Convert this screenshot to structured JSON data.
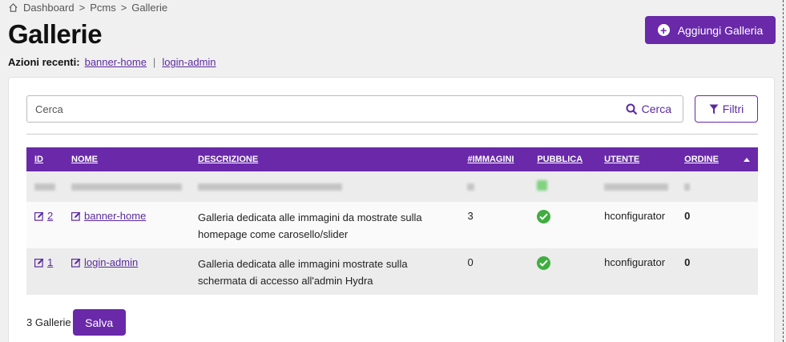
{
  "breadcrumb": {
    "items": [
      "Dashboard",
      "Pcms",
      "Gallerie"
    ],
    "separator": ">"
  },
  "page": {
    "title": "Gallerie"
  },
  "recent": {
    "label": "Azioni recenti",
    "colon": ":",
    "links": [
      "banner-home",
      "login-admin"
    ],
    "separator": "|"
  },
  "actions": {
    "add_label": "Aggiungi Galleria",
    "filter_label": "Filtri",
    "search_label": "Cerca"
  },
  "search": {
    "placeholder": "Cerca",
    "value": ""
  },
  "table": {
    "headers": {
      "id": "ID",
      "nome": "NOME",
      "descrizione": "DESCRIZIONE",
      "immagini": "#IMMAGINI",
      "pubblica": "PUBBLICA",
      "utente": "UTENTE",
      "ordine": "ORDINE"
    },
    "rows": [
      {
        "id": "2",
        "nome": "banner-home",
        "descrizione": "Galleria dedicata alle immagini da mostrate sulla homepage come carosello/slider",
        "immagini": "3",
        "pubblica": true,
        "utente": "hconfigurator",
        "ordine": "0"
      },
      {
        "id": "1",
        "nome": "login-admin",
        "descrizione": "Galleria dedicata alle immagini mostrate sulla schermata di accesso all'admin Hydra",
        "immagini": "0",
        "pubblica": true,
        "utente": "hconfigurator",
        "ordine": "0"
      }
    ]
  },
  "footer": {
    "count_label": "3 Gallerie",
    "save_label": "Salva"
  },
  "colors": {
    "accent": "#6929a9",
    "link": "#5b2a9e",
    "success": "#3fae3f"
  }
}
